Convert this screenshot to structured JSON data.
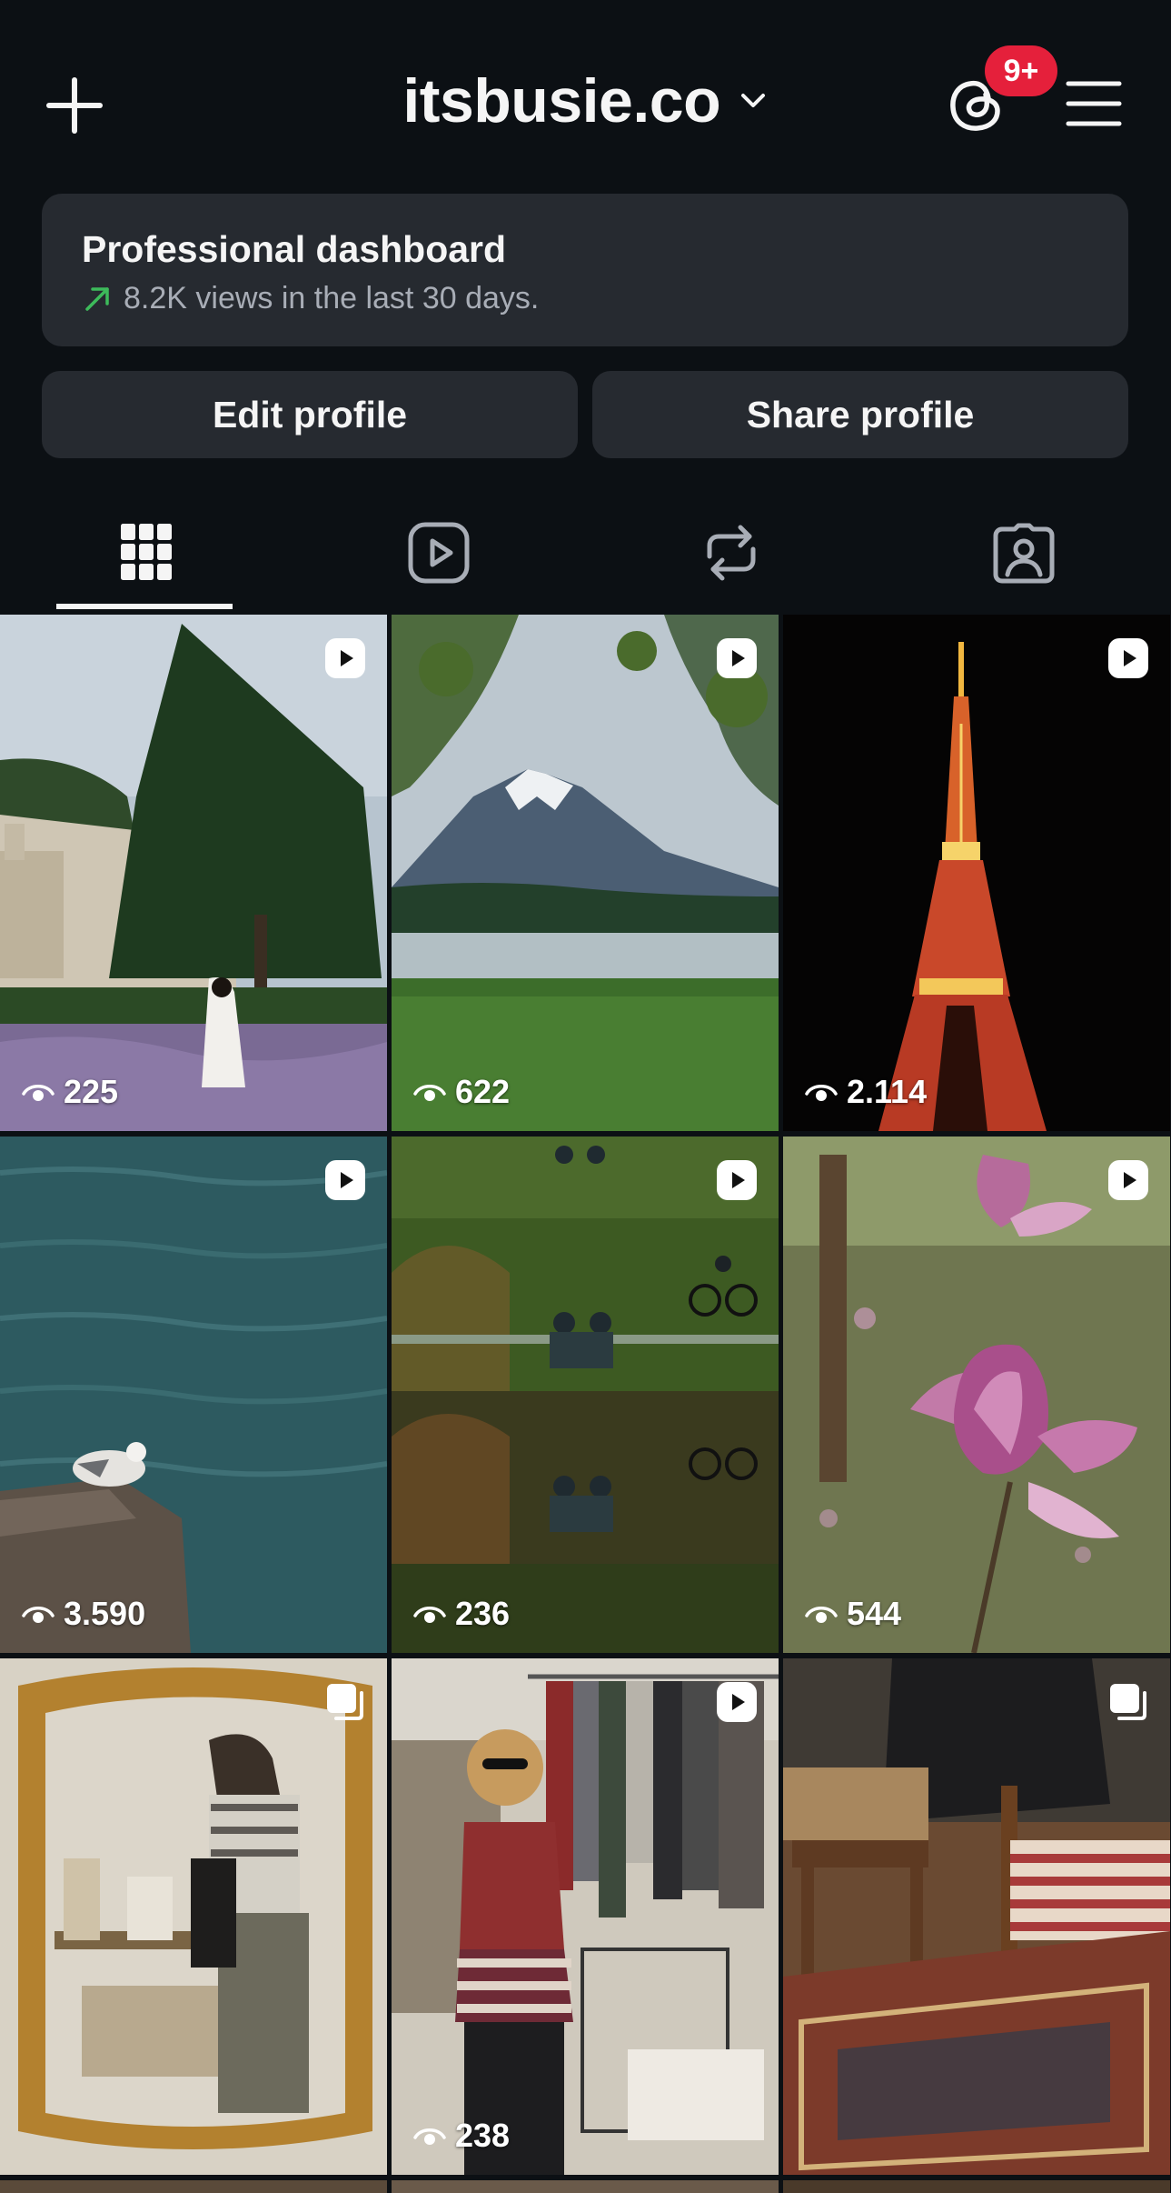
{
  "header": {
    "username": "itsbusie.co",
    "notification_badge": "9+",
    "icons": [
      "plus-icon",
      "chevron-down-icon",
      "threads-icon",
      "hamburger-menu-icon"
    ]
  },
  "dashboard": {
    "title": "Professional dashboard",
    "subtitle": "8.2K views in the last 30 days.",
    "arrow_color": "#3dbb5b"
  },
  "buttons": {
    "edit_profile": "Edit profile",
    "share_profile": "Share profile"
  },
  "tabs": [
    {
      "name": "posts-grid",
      "icon": "grid-icon",
      "active": true
    },
    {
      "name": "reels",
      "icon": "reels-icon",
      "active": false
    },
    {
      "name": "reposts",
      "icon": "repost-icon",
      "active": false
    },
    {
      "name": "tagged",
      "icon": "tagged-person-icon",
      "active": false
    }
  ],
  "posts": [
    {
      "views": "225",
      "type": "reel",
      "subject": "lavender field with stone abbey and pine tree"
    },
    {
      "views": "622",
      "type": "reel",
      "subject": "snow-capped mountain over lake with branches"
    },
    {
      "views": "2.114",
      "type": "reel",
      "subject": "illuminated tower at night"
    },
    {
      "views": "3.590",
      "type": "reel",
      "subject": "seagull on rock by water"
    },
    {
      "views": "236",
      "type": "reel",
      "subject": "people on chairs in park with cyclist"
    },
    {
      "views": "544",
      "type": "reel",
      "subject": "pink magnolia blossom"
    },
    {
      "views": "",
      "type": "carousel",
      "subject": "mirror reflection at flea market"
    },
    {
      "views": "238",
      "type": "reel",
      "subject": "woman browsing clothes rack at market"
    },
    {
      "views": "",
      "type": "carousel",
      "subject": "antique chair and table on rugs"
    }
  ],
  "colors": {
    "background": "#0c1014",
    "card": "#262a30",
    "badge": "#e5203b",
    "text_primary": "#f5f5f5",
    "text_secondary": "#a8adb6"
  }
}
